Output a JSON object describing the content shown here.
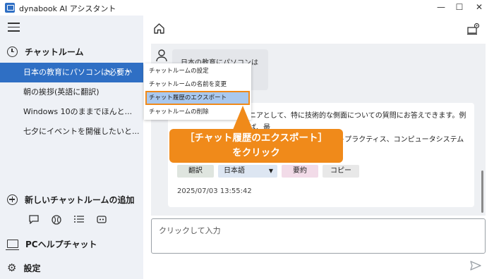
{
  "window": {
    "title": "dynabook AI アシスタント",
    "minimize": "—",
    "maximize": "☐",
    "close": "✕"
  },
  "sidebar": {
    "section_label": "チャットルーム",
    "items": [
      {
        "label": "日本の教育にパソコンは必要か",
        "active": true
      },
      {
        "label": "朝の挨拶(英語に翻訳)"
      },
      {
        "label": "Windows 10のままでほんと..."
      },
      {
        "label": "七夕にイベントを開催したいと..."
      }
    ],
    "more_label": "・・・",
    "new_room_label": "新しいチャットルームの追加",
    "tool_icons": [
      "chat-icon",
      "globe-icon",
      "list-icon",
      "robot-icon"
    ],
    "pc_help_label": "PCヘルプチャット",
    "settings_label": "設定"
  },
  "context_menu": {
    "items": [
      {
        "label": "チャットルームの設定"
      },
      {
        "label": "チャットルームの名前を変更"
      },
      {
        "label": "チャット履歴のエクスポート",
        "highlighted": true
      },
      {
        "label": "チャットルームの削除"
      }
    ]
  },
  "chat": {
    "user_message_line1": "日本の教育にパソコンは必要か?",
    "ai_message_line1": "ジニアとして、特に技術的な側面についての質問にお答えできます。例えば、最",
    "ai_message_line2": "新のプログラミング技術、ソフトウェア開発のベストプラクティス、コンピュータシステムの動作理解など、技術的",
    "buttons": {
      "translate": "翻訳",
      "language": "日本語",
      "summary": "要約",
      "copy": "コピー"
    },
    "timestamp": "2025/07/03 13:55:42"
  },
  "input": {
    "placeholder": "クリックして入力"
  },
  "callout": {
    "line1": "［チャット履歴のエクスポート］",
    "line2": "をクリック"
  },
  "colors": {
    "accent": "#2f6fc4",
    "callout": "#f08a1a",
    "sidebar_bg": "#eef1f6"
  }
}
